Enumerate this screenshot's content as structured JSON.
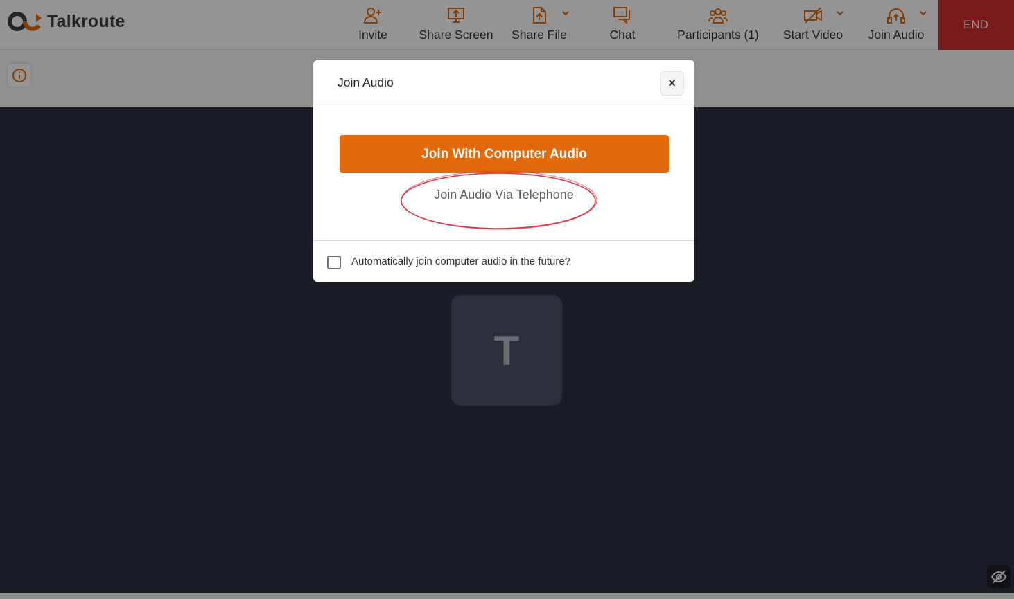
{
  "app": {
    "name": "Talkroute"
  },
  "toolbar": {
    "items": [
      {
        "label": "Invite",
        "icon": "invite-user-icon"
      },
      {
        "label": "Share Screen",
        "icon": "share-screen-icon"
      },
      {
        "label": "Share File",
        "icon": "share-file-icon"
      },
      {
        "label": "Chat",
        "icon": "chat-icon"
      },
      {
        "label": "Participants (1)",
        "icon": "participants-icon"
      },
      {
        "label": "Start Video",
        "icon": "video-off-icon"
      },
      {
        "label": "Join Audio",
        "icon": "headphones-icon"
      }
    ],
    "end_label": "END"
  },
  "participant": {
    "initial": "T"
  },
  "modal": {
    "title": "Join Audio",
    "close_label": "×",
    "primary_label": "Join With Computer Audio",
    "telephone_label": "Join Audio Via Telephone",
    "auto_join_label": "Automatically join computer audio in the future?",
    "auto_join_checked": false
  },
  "colors": {
    "accent": "#e2690a",
    "end": "#d32d2d",
    "stage": "#2f3240",
    "annotation": "#e0333f"
  }
}
